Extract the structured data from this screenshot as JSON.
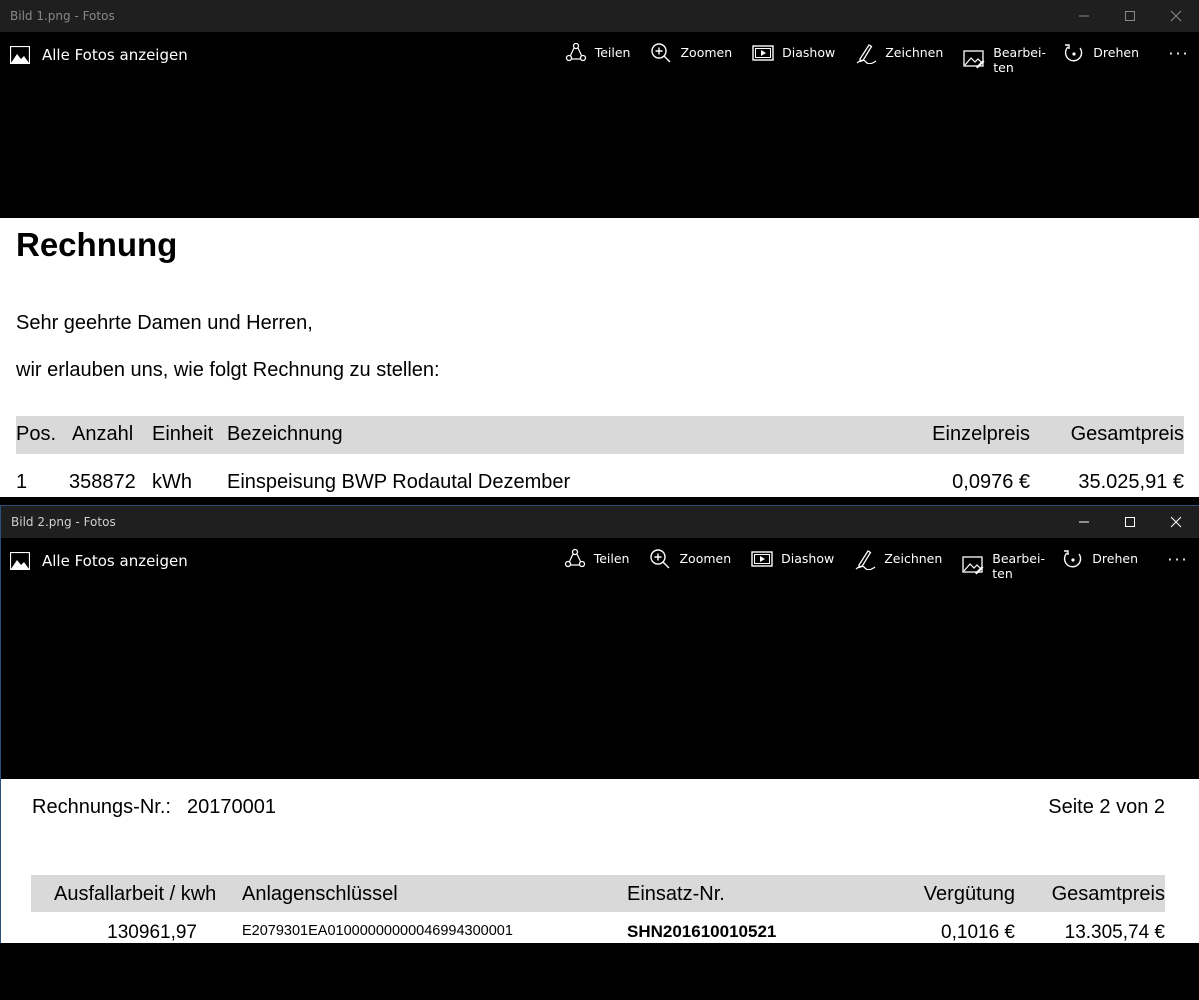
{
  "window1": {
    "title": "Bild 1.png - Fotos",
    "toolbar": {
      "all_photos": "Alle Fotos anzeigen",
      "share": "Teilen",
      "zoom": "Zoomen",
      "slideshow": "Diashow",
      "draw": "Zeichnen",
      "edit": "Bearbei-\nten",
      "rotate": "Drehen",
      "more": "···"
    },
    "document": {
      "heading": "Rechnung",
      "greeting": "Sehr geehrte Damen und Herren,",
      "intro": "wir erlauben uns, wie folgt Rechnung zu stellen:",
      "columns": [
        "Pos.",
        "Anzahl",
        "Einheit",
        "Bezeichnung",
        "Einzelpreis",
        "Gesamtpreis"
      ],
      "rows": [
        [
          "1",
          "358872",
          "kWh",
          "Einspeisung BWP Rodautal Dezember",
          "0,0976 €",
          "35.025,91 €"
        ]
      ]
    }
  },
  "window2": {
    "title": "Bild 2.png - Fotos",
    "toolbar": {
      "all_photos": "Alle Fotos anzeigen",
      "share": "Teilen",
      "zoom": "Zoomen",
      "slideshow": "Diashow",
      "draw": "Zeichnen",
      "edit": "Bearbei-\nten",
      "rotate": "Drehen",
      "more": "···"
    },
    "document": {
      "invoice_label": "Rechnungs-Nr.:",
      "invoice_no": "20170001",
      "page": "Seite 2 von 2",
      "columns": [
        "Ausfallarbeit / kwh",
        "Anlagenschlüssel",
        "Einsatz-Nr.",
        "Vergütung",
        "Gesamtpreis"
      ],
      "rows": [
        [
          "130961,97",
          "E2079301EA01000000000046994300001",
          "SHN201610010521",
          "0,1016 €",
          "13.305,74 €"
        ]
      ]
    }
  }
}
